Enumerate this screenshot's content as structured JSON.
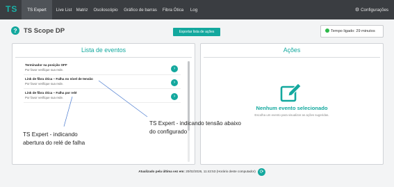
{
  "brand": "TS",
  "nav": {
    "items": [
      "TS Expert",
      "Live List",
      "Matriz",
      "Osciloscópio",
      "Gráfico de barras",
      "Fibra Ótica",
      "Log"
    ],
    "active": "TS Expert",
    "config_label": "Configurações"
  },
  "header": {
    "title": "TS Scope DP",
    "export_label": "Exportar lista de ações",
    "uptime_label": "Tempo ligado: 29 minutos"
  },
  "events": {
    "title": "Lista de eventos",
    "items": [
      {
        "title": "Terminador na posição OFF",
        "subtitle": "Por favor verifique sua rede."
      },
      {
        "title": "Link de fibra ótica – Falha no nível de tensão",
        "subtitle": "Por favor verifique sua rede."
      },
      {
        "title": "Link de fibra ótica – Falha por relé",
        "subtitle": "Por favor verifique sua rede."
      }
    ]
  },
  "actions": {
    "title": "Ações",
    "empty_title": "Nenhum evento selecionado",
    "empty_subtitle": "Escolha um evento para visualizar as ações sugeridas."
  },
  "annotations": {
    "relay_line1": "TS Expert - indicando",
    "relay_line2": "abertura do relé de falha",
    "tension_line1": "TS Expert - indicando tensão abaixo",
    "tension_line2": "do configurado"
  },
  "footer": {
    "label": "Atualizado pela última vez em:",
    "timestamp": "20/02/2026, 11:42:53 (Horário deste computador)"
  },
  "colors": {
    "accent": "#13a89e",
    "navbar": "#3a3d41",
    "status_ok": "#2db84a"
  },
  "icons": [
    "question-icon",
    "gear-icon",
    "clock-icon",
    "chevron-right-icon",
    "edit-icon",
    "refresh-icon"
  ]
}
